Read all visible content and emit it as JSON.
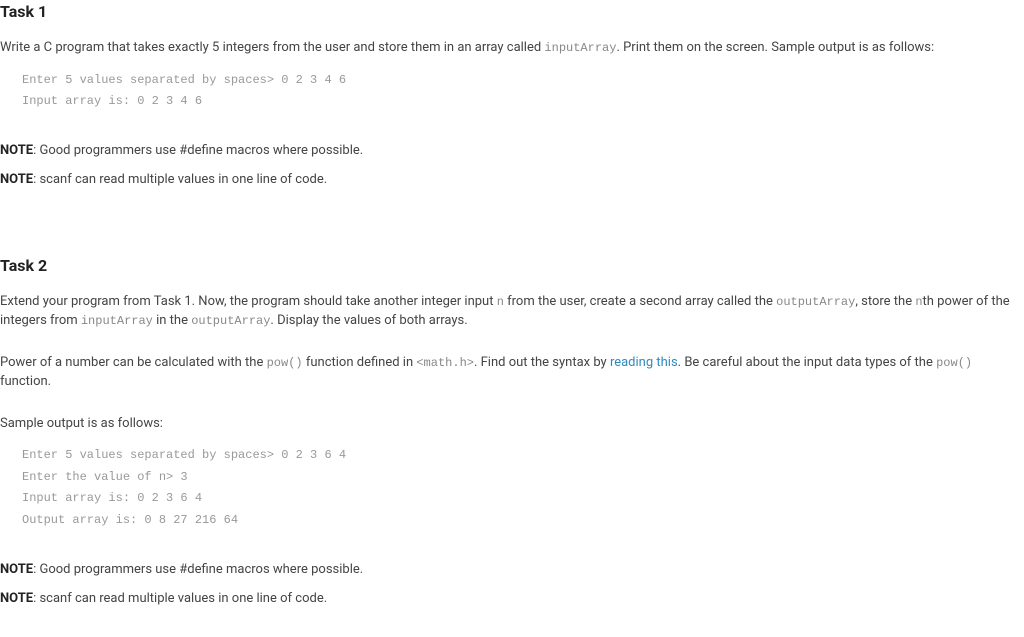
{
  "task1": {
    "heading": "Task 1",
    "intro_prefix": "Write a C program that takes exactly 5 integers from the user and store them in an array called ",
    "intro_code": "inputArray",
    "intro_suffix": ". Print them on the screen. Sample output is as follows:",
    "sample": "Enter 5 values separated by spaces> 0 2 3 4 6\nInput array is: 0 2 3 4 6",
    "note1_label": "NOTE",
    "note1_text": ": Good programmers use #define macros where possible.",
    "note2_label": "NOTE",
    "note2_text": ": scanf can read multiple values in one line of code."
  },
  "task2": {
    "heading": "Task 2",
    "p1_a": "Extend your program from Task 1. Now, the program should take another integer input ",
    "p1_code1": "n",
    "p1_b": " from the user, create a second array called the ",
    "p1_code2": "outputArray",
    "p1_c": ", store the ",
    "p1_code3": "n",
    "p1_d": "th power of the integers from ",
    "p1_code4": "inputArray",
    "p1_e": " in the ",
    "p1_code5": "outputArray",
    "p1_f": ". Display the values of both arrays.",
    "p2_a": "Power of a number can be calculated with the ",
    "p2_code1": "pow()",
    "p2_b": " function defined in ",
    "p2_code2": "<math.h>",
    "p2_c": ". Find out the syntax by ",
    "p2_link": "reading this",
    "p2_d": ". Be careful about the input data types of the ",
    "p2_code3": "pow()",
    "p2_e": " function.",
    "sample_label": "Sample output is as follows:",
    "sample": "Enter 5 values separated by spaces> 0 2 3 6 4\nEnter the value of n> 3\nInput array is: 0 2 3 6 4\nOutput array is: 0 8 27 216 64",
    "note1_label": "NOTE",
    "note1_text": ": Good programmers use #define macros where possible.",
    "note2_label": "NOTE",
    "note2_text": ": scanf can read multiple values in one line of code."
  }
}
